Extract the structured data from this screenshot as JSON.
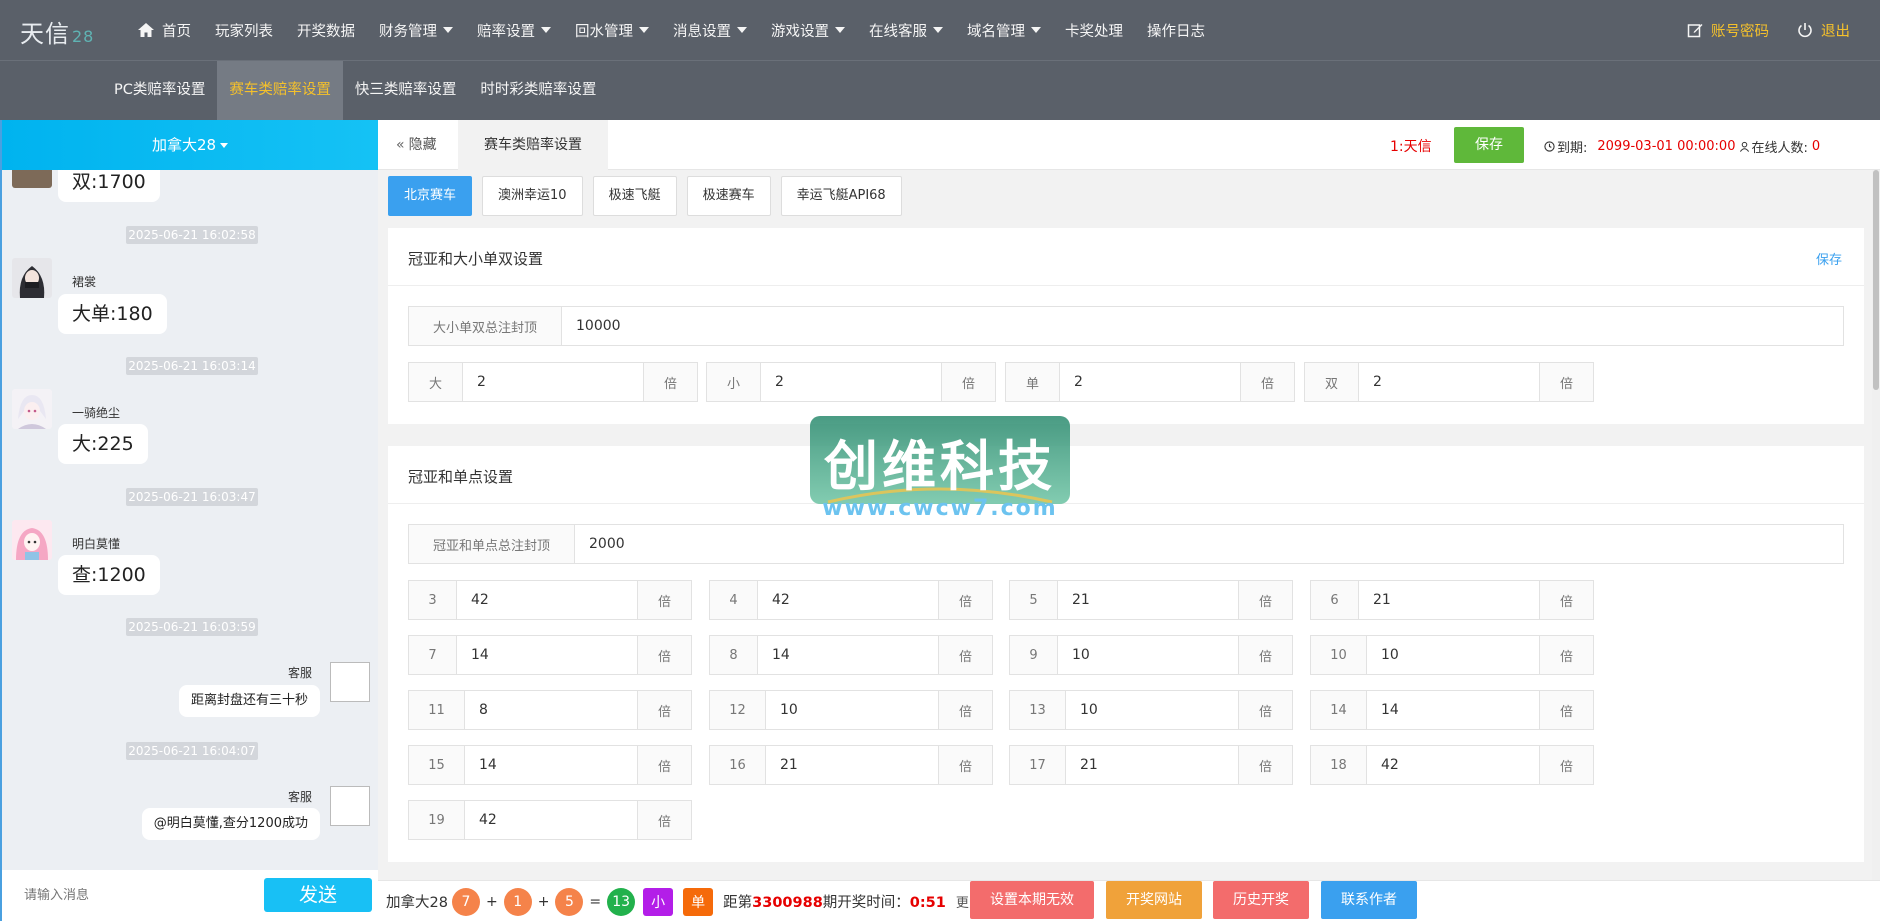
{
  "brand": {
    "name": "天信",
    "number": "28"
  },
  "nav": {
    "items": [
      {
        "label": "首页",
        "dropdown": false,
        "icon": "home-icon"
      },
      {
        "label": "玩家列表",
        "dropdown": false
      },
      {
        "label": "开奖数据",
        "dropdown": false
      },
      {
        "label": "财务管理",
        "dropdown": true
      },
      {
        "label": "赔率设置",
        "dropdown": true
      },
      {
        "label": "回水管理",
        "dropdown": true
      },
      {
        "label": "消息设置",
        "dropdown": true
      },
      {
        "label": "游戏设置",
        "dropdown": true
      },
      {
        "label": "在线客服",
        "dropdown": true
      },
      {
        "label": "域名管理",
        "dropdown": true
      },
      {
        "label": "卡奖处理",
        "dropdown": false
      },
      {
        "label": "操作日志",
        "dropdown": false
      }
    ],
    "account_label": "账号密码",
    "logout_label": "退出"
  },
  "subnav": {
    "items": [
      "PC类赔率设置",
      "赛车类赔率设置",
      "快三类赔率设置",
      "时时彩类赔率设置"
    ],
    "active_index": 1
  },
  "chat": {
    "room_name": "加拿大28",
    "partial_message": "双:1700",
    "messages": [
      {
        "time": "2025-06-21 16:02:58",
        "user": "裙裳",
        "text": "大单:180",
        "side": "left"
      },
      {
        "time": "2025-06-21 16:03:14",
        "user": "一骑绝尘",
        "text": "大:225",
        "side": "left"
      },
      {
        "time": "2025-06-21 16:03:47",
        "user": "明白莫懂",
        "text": "查:1200",
        "side": "left"
      },
      {
        "time": "2025-06-21 16:03:59",
        "user": "客服",
        "text": "距离封盘还有三十秒",
        "side": "right"
      },
      {
        "time": "2025-06-21 16:04:07",
        "user": "客服",
        "text": "@明白莫懂,查分1200成功",
        "side": "right"
      }
    ],
    "input_placeholder": "请输入消息",
    "send_label": "发送"
  },
  "toolbar": {
    "hide_label": "隐藏",
    "active_tab": "赛车类赔率设置",
    "site_label": "1:天信",
    "save_label": "保存",
    "expire_label": "到期:",
    "expire_value": "2099-03-01 00:00:00",
    "online_label": "在线人数:",
    "online_value": "0"
  },
  "game_tabs": {
    "items": [
      "北京赛车",
      "澳洲幸运10",
      "极速飞艇",
      "极速赛车",
      "幸运飞艇API68"
    ],
    "active_index": 0
  },
  "section1": {
    "title": "冠亚和大小单双设置",
    "save_label": "保存",
    "cap_label": "大小单双总注封顶",
    "cap_value": "10000",
    "unit": "倍",
    "options": [
      {
        "label": "大",
        "value": "2"
      },
      {
        "label": "小",
        "value": "2"
      },
      {
        "label": "单",
        "value": "2"
      },
      {
        "label": "双",
        "value": "2"
      }
    ]
  },
  "section2": {
    "title": "冠亚和单点设置",
    "cap_label": "冠亚和单点总注封顶",
    "cap_value": "2000",
    "unit": "倍",
    "points": [
      {
        "label": "3",
        "value": "42"
      },
      {
        "label": "4",
        "value": "42"
      },
      {
        "label": "5",
        "value": "21"
      },
      {
        "label": "6",
        "value": "21"
      },
      {
        "label": "7",
        "value": "14"
      },
      {
        "label": "8",
        "value": "14"
      },
      {
        "label": "9",
        "value": "10"
      },
      {
        "label": "10",
        "value": "10"
      },
      {
        "label": "11",
        "value": "8"
      },
      {
        "label": "12",
        "value": "10"
      },
      {
        "label": "13",
        "value": "10"
      },
      {
        "label": "14",
        "value": "14"
      },
      {
        "label": "15",
        "value": "14"
      },
      {
        "label": "16",
        "value": "21"
      },
      {
        "label": "17",
        "value": "21"
      },
      {
        "label": "18",
        "value": "42"
      },
      {
        "label": "19",
        "value": "42"
      }
    ]
  },
  "bottom": {
    "game_label": "加拿大28",
    "balls": [
      {
        "value": "7",
        "color": "#f5834a"
      },
      {
        "value": "1",
        "color": "#f5834a"
      },
      {
        "value": "5",
        "color": "#f5834a"
      }
    ],
    "plus": "+",
    "equals": "=",
    "sum": {
      "value": "13",
      "color": "#22b14c"
    },
    "size_tag": {
      "value": "小",
      "color": "#b31ee8"
    },
    "parity_tag": {
      "value": "单",
      "color": "#f56a0a"
    },
    "dist_prefix": "距第",
    "issue": "3300988",
    "dist_mid": "期开奖时间：",
    "countdown": "0:51",
    "more_label": "更多",
    "buttons": [
      {
        "label": "设置本期无效",
        "color": "#f36c6c"
      },
      {
        "label": "开奖网站",
        "color": "#f0a23a"
      },
      {
        "label": "历史开奖",
        "color": "#f36c6c"
      },
      {
        "label": "联系作者",
        "color": "#3aa0ef"
      }
    ]
  },
  "watermark": {
    "text": "创维科技",
    "url": "www.cwcw7.com"
  }
}
